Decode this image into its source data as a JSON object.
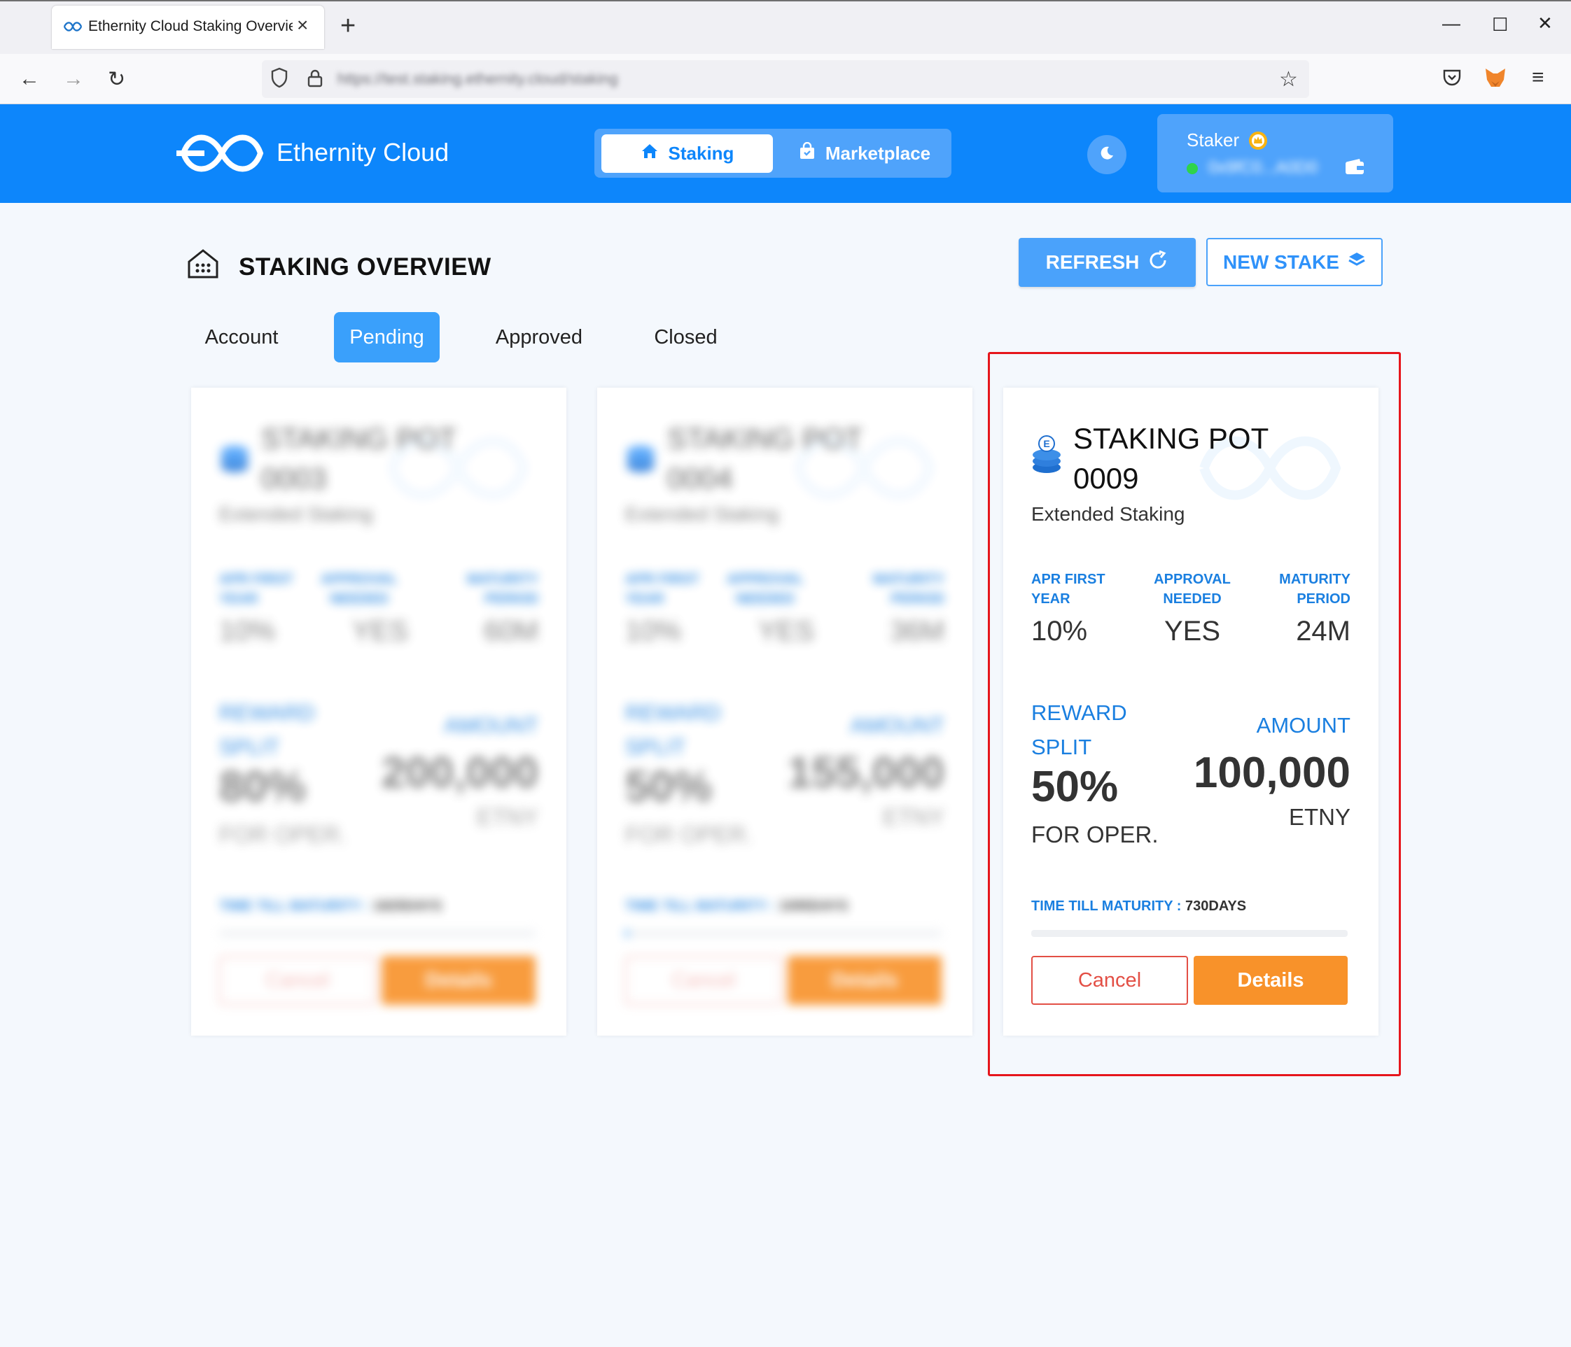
{
  "browser": {
    "tab_title": "Ethernity Cloud Staking Overview",
    "url": "https://test.staking.ethernity.cloud/staking"
  },
  "header": {
    "brand": "Ethernity Cloud",
    "nav": {
      "staking": "Staking",
      "marketplace": "Marketplace"
    },
    "user": {
      "role": "Staker",
      "address": "0x9fC0...A0D0"
    }
  },
  "page": {
    "title": "STAKING OVERVIEW",
    "refresh_label": "REFRESH",
    "new_stake_label": "NEW STAKE",
    "tabs": [
      "Account",
      "Pending",
      "Approved",
      "Closed"
    ],
    "active_tab": "Pending"
  },
  "cards": [
    {
      "title_line1": "STAKING POT",
      "title_line2": "0003",
      "type": "Extended Staking",
      "apr_label": "APR FIRST YEAR",
      "apr": "10%",
      "approval_label": "APPROVAL NEEDED",
      "approval": "YES",
      "maturity_label": "MATURITY PERIOD",
      "maturity": "60M",
      "reward_label_1": "REWARD",
      "reward_label_2": "SPLIT",
      "reward_value": "80%",
      "reward_sub": "FOR OPER.",
      "amount_label": "AMOUNT",
      "amount": "200,000",
      "unit": "ETNY",
      "ttm_label": "TIME TILL MATURITY :",
      "ttm_value": "1825DAYS",
      "progress": 0,
      "cancel_label": "Cancel",
      "details_label": "Details"
    },
    {
      "title_line1": "STAKING POT",
      "title_line2": "0004",
      "type": "Extended Staking",
      "apr_label": "APR FIRST YEAR",
      "apr": "10%",
      "approval_label": "APPROVAL NEEDED",
      "approval": "YES",
      "maturity_label": "MATURITY PERIOD",
      "maturity": "36M",
      "reward_label_1": "REWARD",
      "reward_label_2": "SPLIT",
      "reward_value": "50%",
      "reward_sub": "FOR OPER.",
      "amount_label": "AMOUNT",
      "amount": "155,000",
      "unit": "ETNY",
      "ttm_label": "TIME TILL MATURITY :",
      "ttm_value": "1095DAYS",
      "progress": 0.01,
      "cancel_label": "Cancel",
      "details_label": "Details"
    },
    {
      "title_line1": "STAKING POT",
      "title_line2": "0009",
      "type": "Extended Staking",
      "apr_label": "APR FIRST YEAR",
      "apr": "10%",
      "approval_label": "APPROVAL NEEDED",
      "approval": "YES",
      "maturity_label": "MATURITY PERIOD",
      "maturity": "24M",
      "reward_label_1": "REWARD",
      "reward_label_2": "SPLIT",
      "reward_value": "50%",
      "reward_sub": "FOR OPER.",
      "amount_label": "AMOUNT",
      "amount": "100,000",
      "unit": "ETNY",
      "ttm_label": "TIME TILL MATURITY :",
      "ttm_value": "730DAYS",
      "progress": 0,
      "cancel_label": "Cancel",
      "details_label": "Details"
    }
  ],
  "colors": {
    "brand_blue": "#0d86fb",
    "accent_orange": "#f8922a",
    "danger_red": "#e34f45",
    "highlight_red": "#e6161c"
  }
}
